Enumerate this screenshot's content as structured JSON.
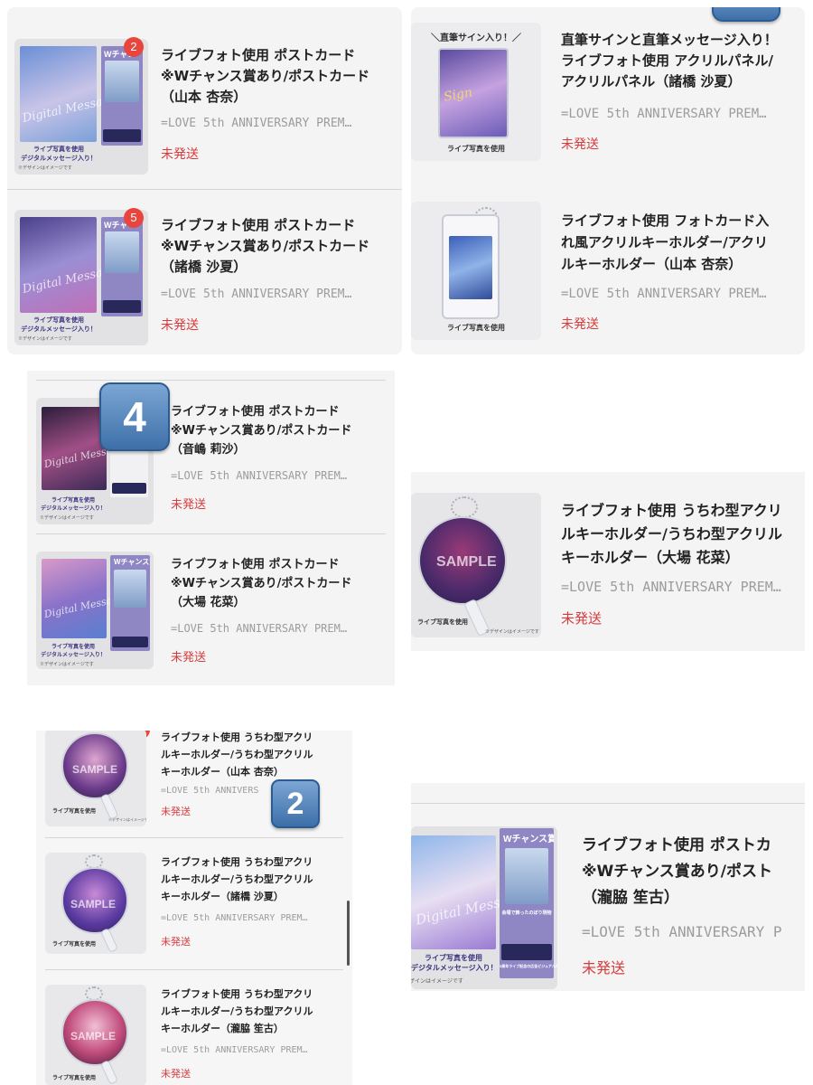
{
  "colors": {
    "status": "#d83b3b",
    "badge": "#e8453c",
    "panel": "#f4f4f5",
    "subtitle": "#9c9c9c"
  },
  "common": {
    "subtitle": "=LOVE 5th ANNIVERSARY PREM…",
    "subtitle_cut": "=LOVE 5th ANNIVERSARY P",
    "subtitle_cut2": "=LOVE 5th ANNIVERS",
    "status": "未発送",
    "photo_caption": "ライブ写真を使用",
    "photo_caption2": "デジタルメッセージ入り！",
    "design_note": "※デザインはイメージです",
    "chance_label": "Wチャンス賞",
    "chance_short": "Wチャン",
    "chance_tiny": "Wチャ",
    "watermark": "Digital Message",
    "sample": "SAMPLE",
    "poster_note": "5周年ライブ記念の広告ビジュアルのポスター",
    "venue_note": "会場で飾ったのぼり現物"
  },
  "panel_a": {
    "items": [
      {
        "badge": "2",
        "lines": [
          "ライブフォト使用 ポストカード",
          "※Wチャンス賞あり/ポストカード",
          "（山本 杏奈）"
        ]
      },
      {
        "badge": "5",
        "lines": [
          "ライブフォト使用 ポストカード",
          "※Wチャンス賞あり/ポストカード",
          "（諸橋 沙夏）"
        ]
      }
    ]
  },
  "panel_b": {
    "items": [
      {
        "sign_caption": "＼直筆サイン入り！／",
        "lines": [
          "直筆サインと直筆メッセージ入り！",
          "ライブフォト使用 アクリルパネル/",
          "アクリルパネル（諸橋 沙夏）"
        ]
      },
      {
        "lines": [
          "ライブフォト使用 フォトカード入",
          "れ風アクリルキーホルダー/アクリ",
          "ルキーホルダー（山本 杏奈）"
        ]
      }
    ]
  },
  "panel_c": {
    "keycap": "4",
    "items": [
      {
        "lines": [
          "ライブフォト使用 ポストカード",
          "※Wチャンス賞あり/ポストカード",
          "（音嶋 莉沙）"
        ]
      },
      {
        "lines": [
          "ライブフォト使用 ポストカード",
          "※Wチャンス賞あり/ポストカード",
          "（大場 花菜）"
        ]
      }
    ]
  },
  "panel_d": {
    "items": [
      {
        "lines": [
          "ライブフォト使用 うちわ型アクリ",
          "ルキーホルダー/うちわ型アクリル",
          "キーホルダー（大場 花菜）"
        ]
      }
    ]
  },
  "panel_e": {
    "keycap": "2",
    "items": [
      {
        "lines": [
          "ライブフォト使用 うちわ型アクリ",
          "ルキーホルダー/うちわ型アクリル",
          "キーホルダー（山本 杏奈）"
        ]
      },
      {
        "lines": [
          "ライブフォト使用 うちわ型アクリ",
          "ルキーホルダー/うちわ型アクリル",
          "キーホルダー（諸橋 沙夏）"
        ]
      },
      {
        "lines": [
          "ライブフォト使用 うちわ型アクリ",
          "ルキーホルダー/うちわ型アクリル",
          "キーホルダー（瀧脇 笙古）"
        ]
      }
    ]
  },
  "panel_f": {
    "items": [
      {
        "lines": [
          "ライブフォト使用 ポストカ",
          "※Wチャンス賞あり/ポスト",
          "（瀧脇 笙古）"
        ]
      }
    ]
  }
}
